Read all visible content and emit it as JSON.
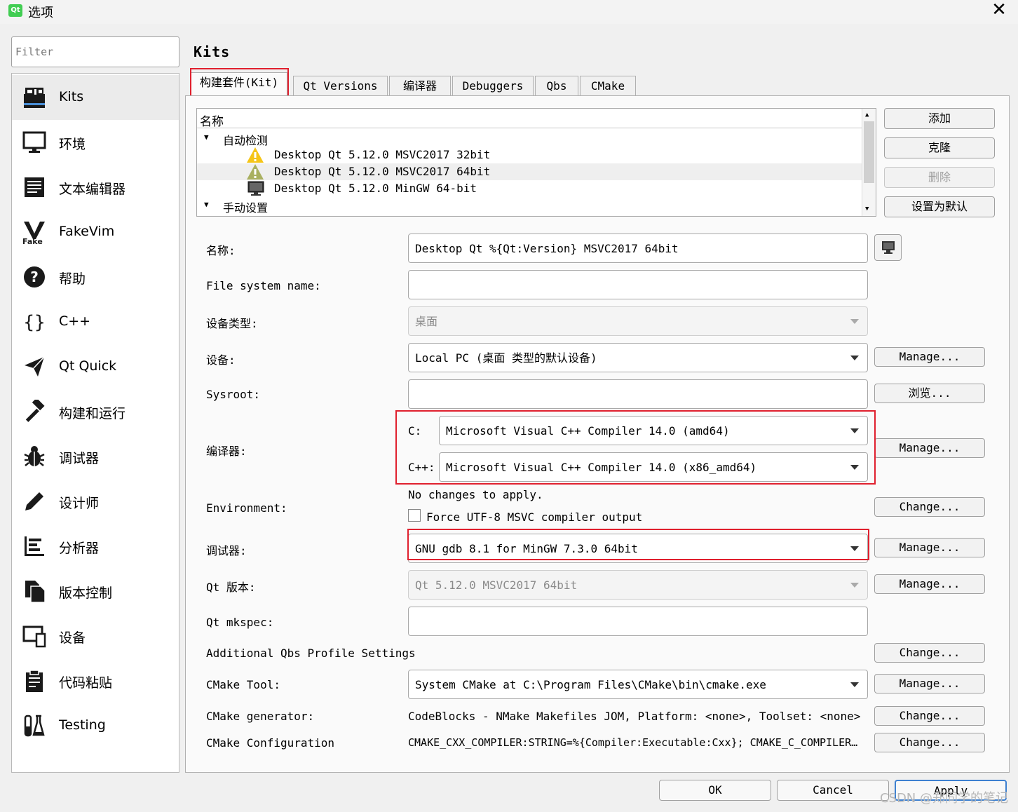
{
  "window": {
    "title": "选项",
    "app_icon_text": "Qt",
    "close_glyph": "✕"
  },
  "filter": {
    "placeholder": "Filter"
  },
  "sidebar": {
    "items": [
      {
        "label": "Kits",
        "icon": "kits-icon",
        "selected": true
      },
      {
        "label": "环境",
        "icon": "monitor-icon"
      },
      {
        "label": "文本编辑器",
        "icon": "text-editor-icon"
      },
      {
        "label": "FakeVim",
        "icon": "fakevim-icon"
      },
      {
        "label": "帮助",
        "icon": "help-icon"
      },
      {
        "label": "C++",
        "icon": "braces-icon"
      },
      {
        "label": "Qt Quick",
        "icon": "paper-plane-icon"
      },
      {
        "label": "构建和运行",
        "icon": "hammer-icon"
      },
      {
        "label": "调试器",
        "icon": "bug-icon"
      },
      {
        "label": "设计师",
        "icon": "pencil-icon"
      },
      {
        "label": "分析器",
        "icon": "analyzer-icon"
      },
      {
        "label": "版本控制",
        "icon": "version-control-icon"
      },
      {
        "label": "设备",
        "icon": "device-icon"
      },
      {
        "label": "代码粘贴",
        "icon": "clipboard-icon"
      },
      {
        "label": "Testing",
        "icon": "test-tubes-icon"
      }
    ]
  },
  "page": {
    "title": "Kits"
  },
  "tabs": [
    {
      "label": "构建套件(Kit)",
      "selected": true
    },
    {
      "label": "Qt Versions"
    },
    {
      "label": "编译器"
    },
    {
      "label": "Debuggers"
    },
    {
      "label": "Qbs"
    },
    {
      "label": "CMake"
    }
  ],
  "kit_list": {
    "header": "名称",
    "groups": [
      {
        "label": "自动检测",
        "expanded": true,
        "kits": [
          {
            "label": "Desktop Qt 5.12.0 MSVC2017 32bit",
            "icon": "warning-icon"
          },
          {
            "label": "Desktop Qt 5.12.0 MSVC2017 64bit",
            "icon": "warning-icon",
            "selected": true
          },
          {
            "label": "Desktop Qt 5.12.0 MinGW 64-bit",
            "icon": "monitor-icon"
          }
        ]
      },
      {
        "label": "手动设置",
        "expanded": true,
        "kits": []
      }
    ],
    "buttons": {
      "add": "添加",
      "clone": "克隆",
      "remove": "删除",
      "make_default": "设置为默认"
    }
  },
  "form": {
    "name": {
      "label": "名称:",
      "value": "Desktop Qt %{Qt:Version} MSVC2017 64bit"
    },
    "fs_name": {
      "label": "File system name:",
      "value": ""
    },
    "device_type": {
      "label": "设备类型:",
      "value": "桌面"
    },
    "device": {
      "label": "设备:",
      "value": "Local PC (桌面 类型的默认设备)",
      "button": "Manage..."
    },
    "sysroot": {
      "label": "Sysroot:",
      "value": "",
      "button": "浏览..."
    },
    "compiler": {
      "label": "编译器:",
      "c_label": "C:",
      "c_value": "Microsoft Visual C++ Compiler 14.0 (amd64)",
      "cxx_label": "C++:",
      "cxx_value": "Microsoft Visual C++ Compiler 14.0 (x86_amd64)",
      "button": "Manage..."
    },
    "environment": {
      "label": "Environment:",
      "status": "No changes to apply.",
      "checkbox_label": "Force UTF-8 MSVC compiler output",
      "button": "Change..."
    },
    "debugger": {
      "label": "调试器:",
      "value": "GNU gdb 8.1 for MinGW 7.3.0 64bit",
      "button": "Manage..."
    },
    "qt_version": {
      "label": "Qt 版本:",
      "value": "Qt 5.12.0 MSVC2017 64bit",
      "button": "Manage..."
    },
    "qt_mkspec": {
      "label": "Qt mkspec:",
      "value": ""
    },
    "qbs_profile": {
      "label": "Additional Qbs Profile Settings",
      "button": "Change..."
    },
    "cmake_tool": {
      "label": "CMake Tool:",
      "value": "System CMake at C:\\Program Files\\CMake\\bin\\cmake.exe",
      "button": "Manage..."
    },
    "cmake_generator": {
      "label": "CMake generator:",
      "value": "CodeBlocks - NMake Makefiles JOM, Platform: <none>, Toolset: <none>",
      "button": "Change..."
    },
    "cmake_config": {
      "label": "CMake Configuration",
      "value": "CMAKE_CXX_COMPILER:STRING=%{Compiler:Executable:Cxx}; CMAKE_C_COMPILER…",
      "button": "Change..."
    }
  },
  "footer": {
    "ok": "OK",
    "cancel": "Cancel",
    "apply": "Apply"
  },
  "watermark": "CSDN @郑同学的笔记",
  "colors": {
    "highlight_box": "#e0202e",
    "warning": "#f5c518"
  }
}
